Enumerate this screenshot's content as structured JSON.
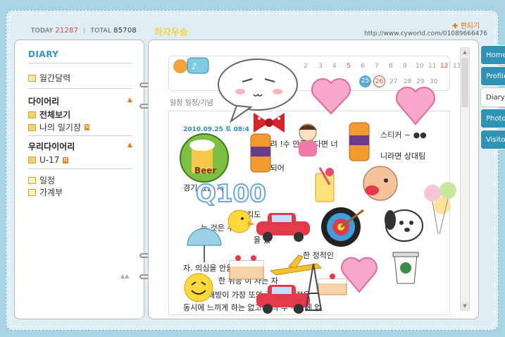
{
  "counter": {
    "today_label": "TODAY",
    "today_value": "21287",
    "total_label": "TOTAL",
    "total_value": "85708"
  },
  "homepage_title": "하자우승",
  "edit_link": "편되기",
  "url": "http://www.cyworld.com/01089666476",
  "sidebar": {
    "title": "DIARY",
    "monthly": "월간달력",
    "section1": "다이어리",
    "view_all": "전체보기",
    "my_diary": "나의 일기장",
    "section2": "우리다이어리",
    "shared_diary": "U-17",
    "schedule": "일정",
    "ledger": "가계부"
  },
  "calendar": {
    "numbers_row1": [
      "2",
      "3",
      "4",
      "5",
      "6",
      "7",
      "8",
      "9",
      "10",
      "11",
      "12",
      "13"
    ],
    "numbers_row2": [
      "25",
      "26",
      "27",
      "28",
      "29",
      "30"
    ],
    "red_days": [
      "5",
      "12",
      "26"
    ]
  },
  "tabs_label": "일정 일정/기념",
  "post": {
    "date": "2010.09.25 토 08:4",
    "lines": [
      "에 올려 !수 만족한다면 너",
      "니라면 상대팀",
      "이 되어",
      "경기 있는 자.",
      "티킥도",
      "는 것은 수 있",
      "을 했",
      "한 정적인",
      "자. 의심을 안을 하면 침",
      "한 위등 이 자는 자",
      "대방이 가장 또와 존경의 감정을",
      "동시에 느끼게 하는 없고 오직 두 수밖에 없"
    ]
  },
  "side_tabs": [
    "Home",
    "Profile",
    "Diary",
    "Photo",
    "Visitor"
  ],
  "colors": {
    "accent": "#2e9ac4",
    "tab": "#2f93b8",
    "background": "#a9d4e4"
  }
}
